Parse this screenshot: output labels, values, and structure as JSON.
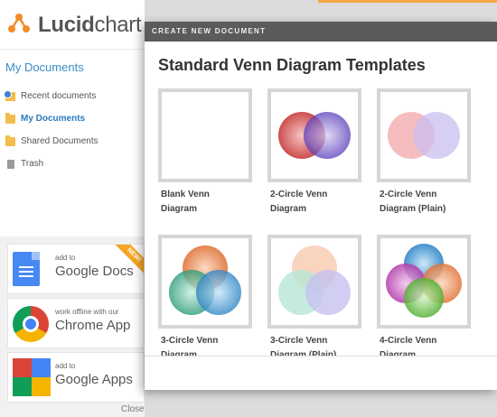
{
  "brand": {
    "name_bold": "Lucid",
    "name_rest": "chart",
    "logo_color": "#f28c28"
  },
  "sidebar": {
    "title": "My Documents",
    "items": [
      {
        "label": "Recent documents",
        "icon": "recent-icon",
        "active": false
      },
      {
        "label": "My Documents",
        "icon": "folder-icon",
        "active": true
      },
      {
        "label": "Shared Documents",
        "icon": "folder-icon",
        "active": false
      },
      {
        "label": "Trash",
        "icon": "trash-icon",
        "active": false
      }
    ],
    "promos": [
      {
        "small": "add to",
        "big": "Google Docs",
        "badge": "NEW!",
        "icon": "google-docs-icon"
      },
      {
        "small": "work offline with our",
        "big": "Chrome App",
        "icon": "chrome-icon"
      },
      {
        "small": "add to",
        "big": "Google Apps",
        "icon": "google-apps-icon"
      }
    ],
    "close_label": "Close"
  },
  "modal": {
    "header": "CREATE NEW DOCUMENT",
    "title": "Standard Venn Diagram Templates",
    "templates": [
      {
        "line1": "Blank Venn",
        "line2": "Diagram",
        "kind": "blank"
      },
      {
        "line1": "2-Circle Venn",
        "line2": "Diagram",
        "kind": "two"
      },
      {
        "line1": "2-Circle Venn",
        "line2": "Diagram (Plain)",
        "kind": "two-plain"
      },
      {
        "line1": "3-Circle Venn",
        "line2": "Diagram",
        "kind": "three"
      },
      {
        "line1": "3-Circle Venn",
        "line2": "Diagram (Plain)",
        "kind": "three-plain"
      },
      {
        "line1": "4-Circle Venn",
        "line2": "Diagram",
        "kind": "four"
      }
    ]
  },
  "colors": {
    "accent_blue": "#3a8cc6",
    "venn_red": "#d94a4a",
    "venn_purple": "#6a4fc4",
    "venn_orange": "#e8844a",
    "venn_teal": "#3aa88a",
    "venn_blue": "#3a94d4",
    "venn_green": "#6bc24a",
    "venn_magenta": "#c84ac0"
  }
}
